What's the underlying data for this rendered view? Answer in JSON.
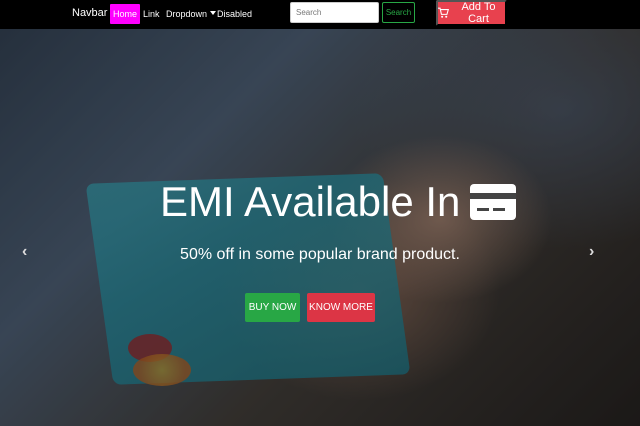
{
  "navbar": {
    "brand": "Navbar",
    "items": [
      {
        "label": "Home",
        "active": true
      },
      {
        "label": "Link"
      },
      {
        "label": "Dropdown"
      },
      {
        "label": "Disabled"
      }
    ],
    "search": {
      "placeholder": "Search",
      "button": "Search"
    },
    "cart": {
      "label": "Add To Cart",
      "icon": "cart-icon"
    }
  },
  "hero": {
    "title": "EMI Available In",
    "title_icon": "credit-card-icon",
    "subtitle": "50% off in some popular brand product.",
    "buttons": {
      "buy": "BUY NOW",
      "know": "KNOW MORE"
    },
    "controls": {
      "prev": "‹",
      "next": "›"
    }
  },
  "colors": {
    "home_active": "#ff00ff",
    "search_green": "#28a745",
    "cart_red": "#e8414e",
    "buy_green": "#28a745",
    "know_red": "#dc3545"
  }
}
